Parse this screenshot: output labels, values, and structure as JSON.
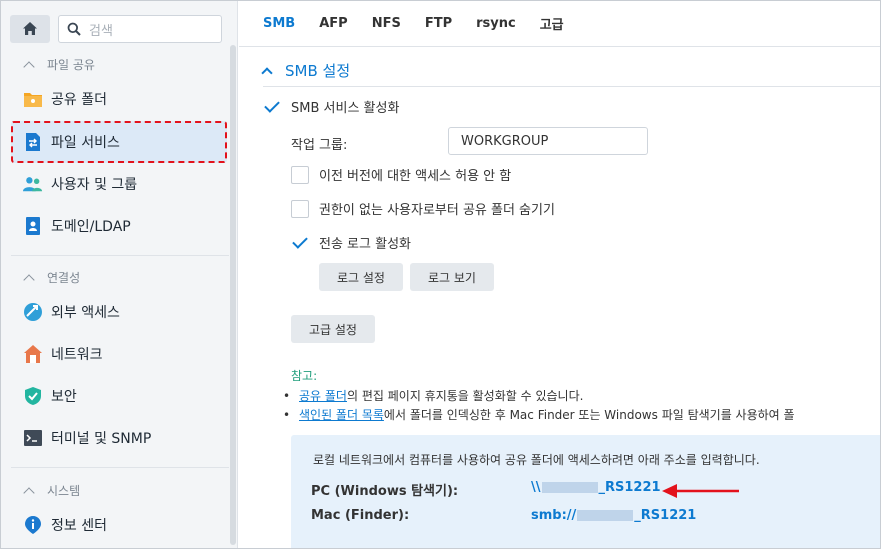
{
  "sidebar": {
    "search_placeholder": "검색",
    "sections": [
      {
        "label": "파일 공유"
      },
      {
        "label": "연결성"
      },
      {
        "label": "시스템"
      }
    ],
    "items": [
      {
        "label": "공유 폴더",
        "icon": "folder-icon"
      },
      {
        "label": "파일 서비스",
        "icon": "file-services-icon"
      },
      {
        "label": "사용자 및 그룹",
        "icon": "users-icon"
      },
      {
        "label": "도메인/LDAP",
        "icon": "domain-icon"
      },
      {
        "label": "외부 액세스",
        "icon": "external-access-icon"
      },
      {
        "label": "네트워크",
        "icon": "network-icon"
      },
      {
        "label": "보안",
        "icon": "shield-icon"
      },
      {
        "label": "터미널 및 SNMP",
        "icon": "terminal-icon"
      },
      {
        "label": "정보 센터",
        "icon": "info-icon"
      }
    ],
    "active_item": "파일 서비스"
  },
  "tabs": [
    "SMB",
    "AFP",
    "NFS",
    "FTP",
    "rsync",
    "고급"
  ],
  "active_tab": "SMB",
  "smb": {
    "section_title": "SMB 설정",
    "enable_label": "SMB 서비스 활성화",
    "enable_checked": true,
    "workgroup_label": "작업 그룹:",
    "workgroup_value": "WORKGROUP",
    "prev_version_label": "이전 버전에 대한 액세스 허용 안 함",
    "prev_version_checked": false,
    "hide_label": "권한이 없는 사용자로부터 공유 폴더 숨기기",
    "hide_checked": false,
    "transfer_log_label": "전송 로그 활성화",
    "transfer_log_checked": true,
    "log_settings_button": "로그 설정",
    "log_view_button": "로그 보기",
    "advanced_button": "고급 설정"
  },
  "note": {
    "title": "참고:",
    "line1_link": "공유 폴더",
    "line1_text": "의 편집 페이지 휴지통을 활성화할 수 있습니다.",
    "line2_link": "색인된 폴더 목록",
    "line2_text": "에서 폴더를 인덱싱한 후 Mac Finder 또는 Windows 파일 탐색기를 사용하여 폴"
  },
  "access": {
    "description": "로컬 네트워크에서 컴퓨터를 사용하여 공유 폴더에 액세스하려면 아래 주소를 입력합니다.",
    "pc_label": "PC (Windows 탐색기):",
    "pc_prefix": "\\\\",
    "pc_suffix": "_RS1221",
    "mac_label": "Mac (Finder):",
    "mac_prefix": "smb://",
    "mac_suffix": "_RS1221"
  },
  "colors": {
    "accent": "#0d7ad0",
    "note_green": "#209e7c",
    "highlight_red": "#e3121c"
  }
}
